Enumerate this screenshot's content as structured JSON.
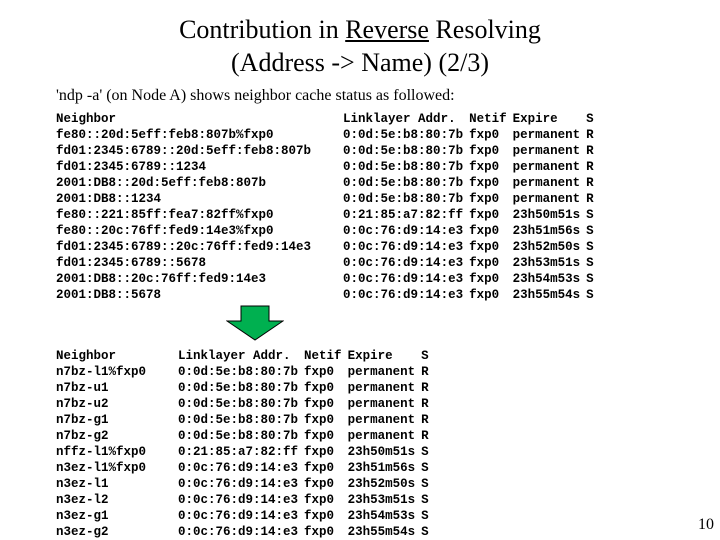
{
  "title": {
    "pre": "Contribution in ",
    "u": "Reverse",
    "post": " Resolving",
    "line2": "(Address -> Name)   (2/3)"
  },
  "intro": "'ndp -a' (on Node A) shows neighbor cache status as followed:",
  "headers": {
    "neighbor": "Neighbor",
    "linklayer": "Linklayer Addr.",
    "netif": "Netif",
    "expire": "Expire",
    "s": "S"
  },
  "table1": [
    {
      "n": "fe80::20d:5eff:feb8:807b%fxp0",
      "l": "0:0d:5e:b8:80:7b",
      "i": "fxp0",
      "e": "permanent",
      "s": "R"
    },
    {
      "n": "fd01:2345:6789::20d:5eff:feb8:807b",
      "l": "0:0d:5e:b8:80:7b",
      "i": "fxp0",
      "e": "permanent",
      "s": "R"
    },
    {
      "n": "fd01:2345:6789::1234",
      "l": "0:0d:5e:b8:80:7b",
      "i": "fxp0",
      "e": "permanent",
      "s": "R"
    },
    {
      "n": "2001:DB8::20d:5eff:feb8:807b",
      "l": "0:0d:5e:b8:80:7b",
      "i": "fxp0",
      "e": "permanent",
      "s": "R"
    },
    {
      "n": "2001:DB8::1234",
      "l": "0:0d:5e:b8:80:7b",
      "i": "fxp0",
      "e": "permanent",
      "s": "R"
    },
    {
      "n": "fe80::221:85ff:fea7:82ff%fxp0",
      "l": "0:21:85:a7:82:ff",
      "i": "fxp0",
      "e": "23h50m51s",
      "s": "S"
    },
    {
      "n": "fe80::20c:76ff:fed9:14e3%fxp0",
      "l": "0:0c:76:d9:14:e3",
      "i": "fxp0",
      "e": "23h51m56s",
      "s": "S"
    },
    {
      "n": "fd01:2345:6789::20c:76ff:fed9:14e3",
      "l": "0:0c:76:d9:14:e3",
      "i": "fxp0",
      "e": "23h52m50s",
      "s": "S"
    },
    {
      "n": "fd01:2345:6789::5678",
      "l": "0:0c:76:d9:14:e3",
      "i": "fxp0",
      "e": "23h53m51s",
      "s": "S"
    },
    {
      "n": "2001:DB8::20c:76ff:fed9:14e3",
      "l": "0:0c:76:d9:14:e3",
      "i": "fxp0",
      "e": "23h54m53s",
      "s": "S"
    },
    {
      "n": "2001:DB8::5678",
      "l": "0:0c:76:d9:14:e3",
      "i": "fxp0",
      "e": "23h55m54s",
      "s": "S"
    }
  ],
  "table2": [
    {
      "n": "n7bz-l1%fxp0",
      "l": "0:0d:5e:b8:80:7b",
      "i": "fxp0",
      "e": "permanent",
      "s": "R"
    },
    {
      "n": "n7bz-u1",
      "l": "0:0d:5e:b8:80:7b",
      "i": "fxp0",
      "e": "permanent",
      "s": "R"
    },
    {
      "n": "n7bz-u2",
      "l": "0:0d:5e:b8:80:7b",
      "i": "fxp0",
      "e": "permanent",
      "s": "R"
    },
    {
      "n": "n7bz-g1",
      "l": "0:0d:5e:b8:80:7b",
      "i": "fxp0",
      "e": "permanent",
      "s": "R"
    },
    {
      "n": "n7bz-g2",
      "l": "0:0d:5e:b8:80:7b",
      "i": "fxp0",
      "e": "permanent",
      "s": "R"
    },
    {
      "n": "nffz-l1%fxp0",
      "l": "0:21:85:a7:82:ff",
      "i": "fxp0",
      "e": "23h50m51s",
      "s": "S"
    },
    {
      "n": "n3ez-l1%fxp0",
      "l": "0:0c:76:d9:14:e3",
      "i": "fxp0",
      "e": "23h51m56s",
      "s": "S"
    },
    {
      "n": "n3ez-l1",
      "l": "0:0c:76:d9:14:e3",
      "i": "fxp0",
      "e": "23h52m50s",
      "s": "S"
    },
    {
      "n": "n3ez-l2",
      "l": "0:0c:76:d9:14:e3",
      "i": "fxp0",
      "e": "23h53m51s",
      "s": "S"
    },
    {
      "n": "n3ez-g1",
      "l": "0:0c:76:d9:14:e3",
      "i": "fxp0",
      "e": "23h54m53s",
      "s": "S"
    },
    {
      "n": "n3ez-g2",
      "l": "0:0c:76:d9:14:e3",
      "i": "fxp0",
      "e": "23h55m54s",
      "s": "S"
    }
  ],
  "pagenum": "10",
  "arrow": {
    "fill": "#00b050",
    "stroke": "#000000"
  }
}
